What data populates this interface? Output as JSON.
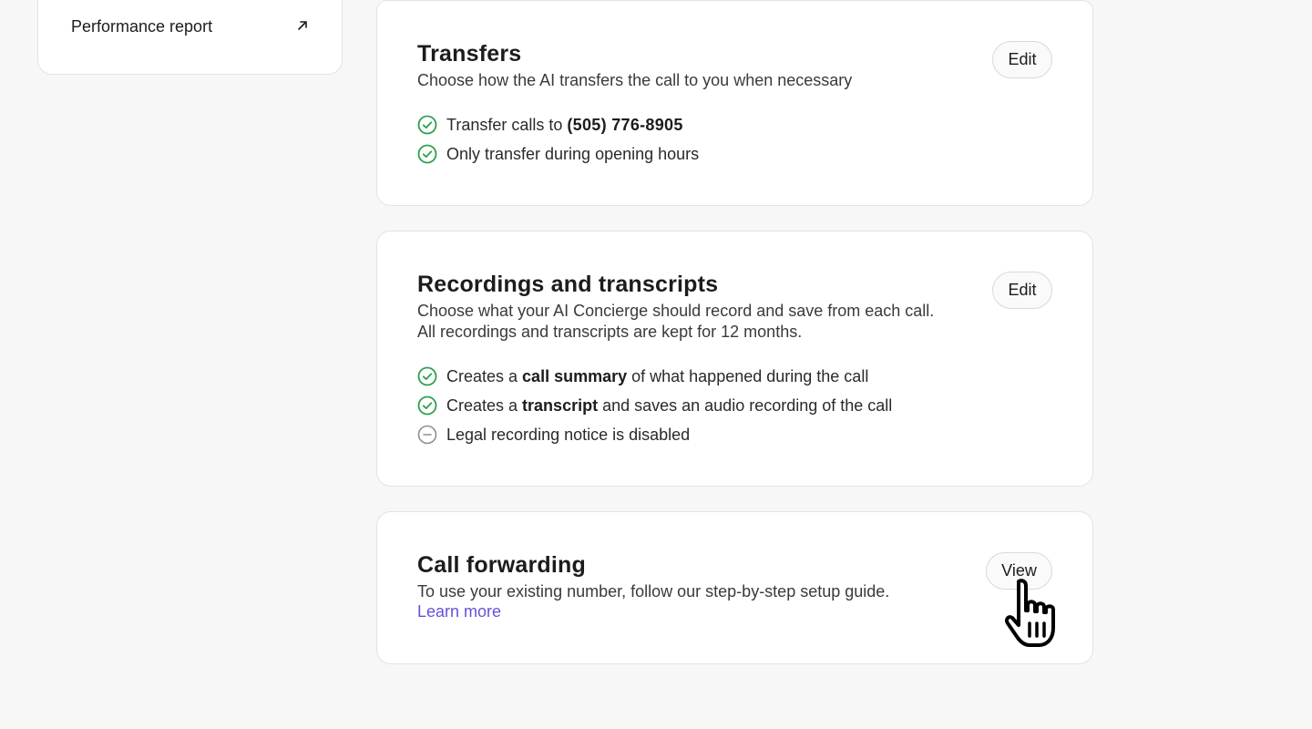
{
  "sidebar": {
    "performance_report": "Performance report"
  },
  "transfers": {
    "title": "Transfers",
    "description": "Choose how the AI transfers the call to you when necessary",
    "edit_label": "Edit",
    "items": [
      {
        "prefix": "Transfer calls to ",
        "phone": "(505) 776-8905",
        "status": "enabled"
      },
      {
        "text": "Only transfer during opening hours",
        "status": "enabled"
      }
    ]
  },
  "recordings": {
    "title": "Recordings and transcripts",
    "description": "Choose what your AI Concierge should record and save from each call. All recordings and transcripts are kept for 12 months.",
    "edit_label": "Edit",
    "items": [
      {
        "prefix": "Creates a ",
        "strong": "call summary",
        "suffix": " of what happened during the call",
        "status": "enabled"
      },
      {
        "prefix": "Creates a ",
        "strong": "transcript",
        "suffix": " and saves an audio recording of the call",
        "status": "enabled"
      },
      {
        "text": "Legal recording notice is disabled",
        "status": "disabled"
      }
    ]
  },
  "forwarding": {
    "title": "Call forwarding",
    "description": "To use your existing number, follow our step-by-step setup guide.",
    "learn_more": "Learn more",
    "view_label": "View"
  },
  "colors": {
    "check_green": "#2e9e4f",
    "disabled_gray": "#8e8e93",
    "link_purple": "#6b4fd8"
  },
  "icons": {
    "enabled": "check-circle-icon",
    "disabled": "minus-circle-icon",
    "external": "arrow-up-right-icon",
    "cursor": "hand-pointer-cursor-icon"
  }
}
